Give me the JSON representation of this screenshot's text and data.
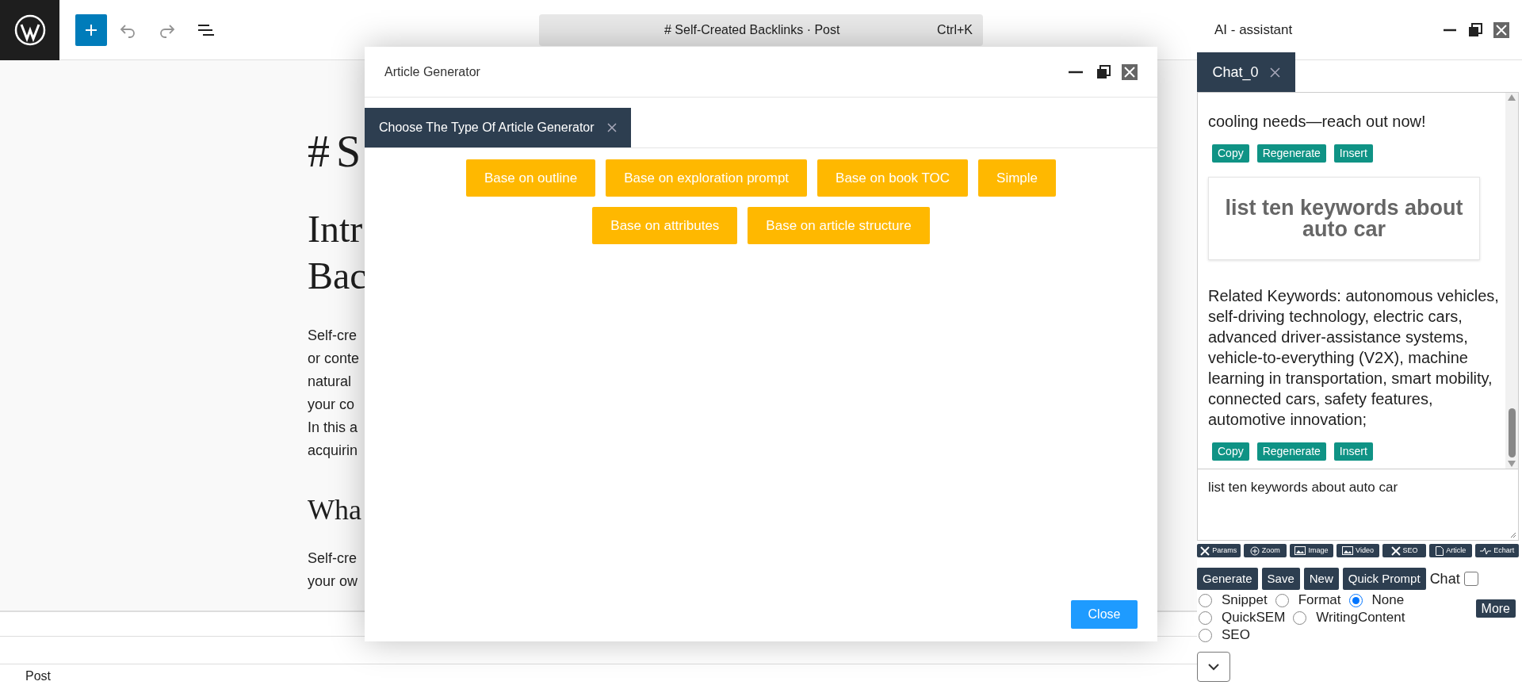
{
  "toolbar": {
    "command_bar": "# Self-Created Backlinks · Post",
    "shortcut": "Ctrl+K"
  },
  "editor": {
    "title": "# S",
    "heading_lines": [
      "Intr",
      "Bac"
    ],
    "paragraph_lines": [
      "Self-cre",
      "or conte",
      "natural",
      "your co",
      "In this a",
      "acquirin"
    ],
    "subheading": "Wha",
    "paragraph2_lines": [
      "Self-cre",
      "your ow"
    ]
  },
  "footer": {
    "breadcrumb": "Post"
  },
  "modal": {
    "title": "Article Generator",
    "tabs": [
      {
        "label": "Choose The Type Of Article Generator",
        "selected": true
      }
    ],
    "option_rows": [
      [
        "Base on outline",
        "Base on exploration prompt",
        "Base on book TOC",
        "Simple"
      ],
      [
        "Base on attributes",
        "Base on article structure"
      ]
    ],
    "close_button": "Close"
  },
  "assistant": {
    "title": "AI - assistant",
    "tabs": [
      {
        "label": "Chat_0",
        "selected": true
      }
    ],
    "messages": [
      {
        "kind": "response",
        "text": "cooling needs—reach out now!",
        "actions": [
          "Copy",
          "Regenerate",
          "Insert"
        ]
      },
      {
        "kind": "prompt",
        "text": "list ten keywords about auto car"
      },
      {
        "kind": "response",
        "text": "Related Keywords: autonomous vehicles, self-driving technology, electric cars, advanced driver-assistance systems, vehicle-to-everything (V2X), machine learning in transportation, smart mobility, connected cars, safety features, automotive innovation;",
        "actions": [
          "Copy",
          "Regenerate",
          "Insert"
        ]
      }
    ],
    "input": {
      "value": "list ten keywords about auto car"
    },
    "tools": [
      "Params",
      "Zoom",
      "Image",
      "Video",
      "SEO",
      "Article",
      "Echart"
    ],
    "buttons": [
      "Generate",
      "Save",
      "New",
      "Quick Prompt"
    ],
    "chat_toggle": {
      "label": "Chat",
      "checked": false
    },
    "modes": [
      {
        "label": "Snippet",
        "selected": false
      },
      {
        "label": "Format",
        "selected": false
      },
      {
        "label": "None",
        "selected": true
      },
      {
        "label": "QuickSEM",
        "selected": false
      },
      {
        "label": "WritingContent",
        "selected": false
      },
      {
        "label": "SEO",
        "selected": false
      }
    ],
    "more_button": "More"
  }
}
